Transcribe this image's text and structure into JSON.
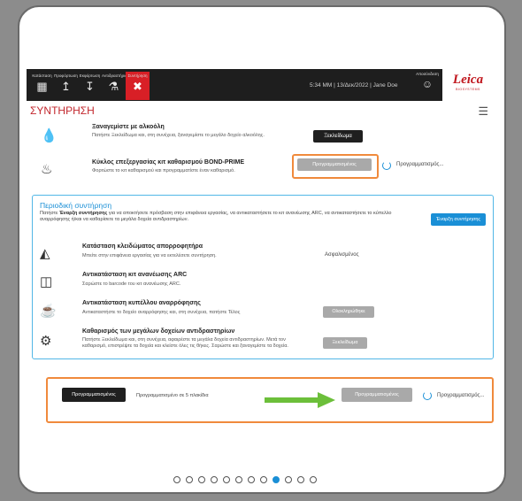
{
  "nav": {
    "tabs": [
      {
        "label": "Κατάσταση",
        "icon": "tray-icon"
      },
      {
        "label": "Προφόρτωση",
        "icon": "preload-icon"
      },
      {
        "label": "Εκφόρτωση",
        "icon": "unload-icon"
      },
      {
        "label": "Αντιδραστήρια",
        "icon": "reagents-icon"
      },
      {
        "label": "Συντήρηση",
        "icon": "maintenance-icon"
      }
    ],
    "active_tab": "Συντήρηση"
  },
  "status_line": "5:34 ΜΜ  |  13/Δεκ/2022  |  Jane Doe",
  "logout_label": "Αποσύνδεση",
  "brand": {
    "name": "Leica",
    "sub": "BIOSYSTEMS"
  },
  "page_title": "ΣΥΝΤΗΡΗΣΗ",
  "rows": {
    "alcohol": {
      "title": "Ξαναγεμίστε με αλκοόλη",
      "desc": "Πατήστε Ξεκλείδωμα και, στη συνέχεια, ξαναγεμίστε το μεγάλο δοχείο αλκοόλης.",
      "button": "Ξεκλείδωμα"
    },
    "cleaning_cycle": {
      "title": "Κύκλος επεξεργασίας κιτ καθαρισμού BOND-PRIME",
      "desc": "Φορτώστε το κιτ καθαρισμού και προγραμματίστε έναν καθαρισμό.",
      "button": "Προγραμματισμένος",
      "status": "Προγραμματισμός..."
    }
  },
  "maintenance": {
    "title": "Περιοδική συντήρηση",
    "desc_prefix": "Πατήστε ",
    "desc_bold": "Έναρξη συντήρησης",
    "desc_suffix": " για να αποκτήσετε πρόσβαση στην επιφάνεια εργασίας, να αντικαταστήσετε το κιτ ανανέωσης ARC, να αντικαταστήσετε το κύπελλο αναρρόφησης ή/και να καθαρίσετε τα μεγάλα δοχεία αντιδραστηρίων.",
    "start_button": "Έναρξη συντήρησης",
    "items": [
      {
        "title": "Κατάσταση κλειδώματος απορροφητήρα",
        "desc": "Μπείτε στην επιφάνεια εργασίας για να εκτελέσετε συντήρηση.",
        "value": "Ασφαλισμένος"
      },
      {
        "title": "Αντικατάσταση κιτ ανανέωσης ARC",
        "desc": "Σαρώστε το barcode του κιτ ανανέωσης ARC."
      },
      {
        "title": "Αντικατάσταση κυπέλλου αναρρόφησης",
        "desc": "Αντικαταστήστε το δοχείο αναρρόφησης και, στη συνέχεια, πατήστε Τέλος",
        "button": "Ολοκληρώθηκε"
      },
      {
        "title": "Καθαρισμός των μεγάλων δοχείων αντιδραστηρίων",
        "desc": "Πατήστε Ξεκλείδωμα και, στη συνέχεια, αφαιρέστε τα μεγάλα δοχεία αντιδραστηρίων. Μετά τον καθαρισμό, επιστρέψτε τα δοχεία και κλείστε όλες τις θήκες. Σαρώστε και ξαναγεμίστε τα δοχεία.",
        "button": "Ξεκλείδωμα"
      }
    ]
  },
  "schedule_panel": {
    "left_button": "Προγραμματισμένος",
    "left_text": "Προγραμματισμένο σε 5 πλακίδια",
    "right_button": "Προγραμματισμένος",
    "right_status": "Προγραμματισμός..."
  },
  "pagination": {
    "total": 12,
    "active": 8
  },
  "colors": {
    "brand_red": "#c0161d",
    "accent_blue": "#1a8fd6",
    "highlight_orange": "#f08a3c",
    "arrow_green": "#6cbf3a"
  }
}
